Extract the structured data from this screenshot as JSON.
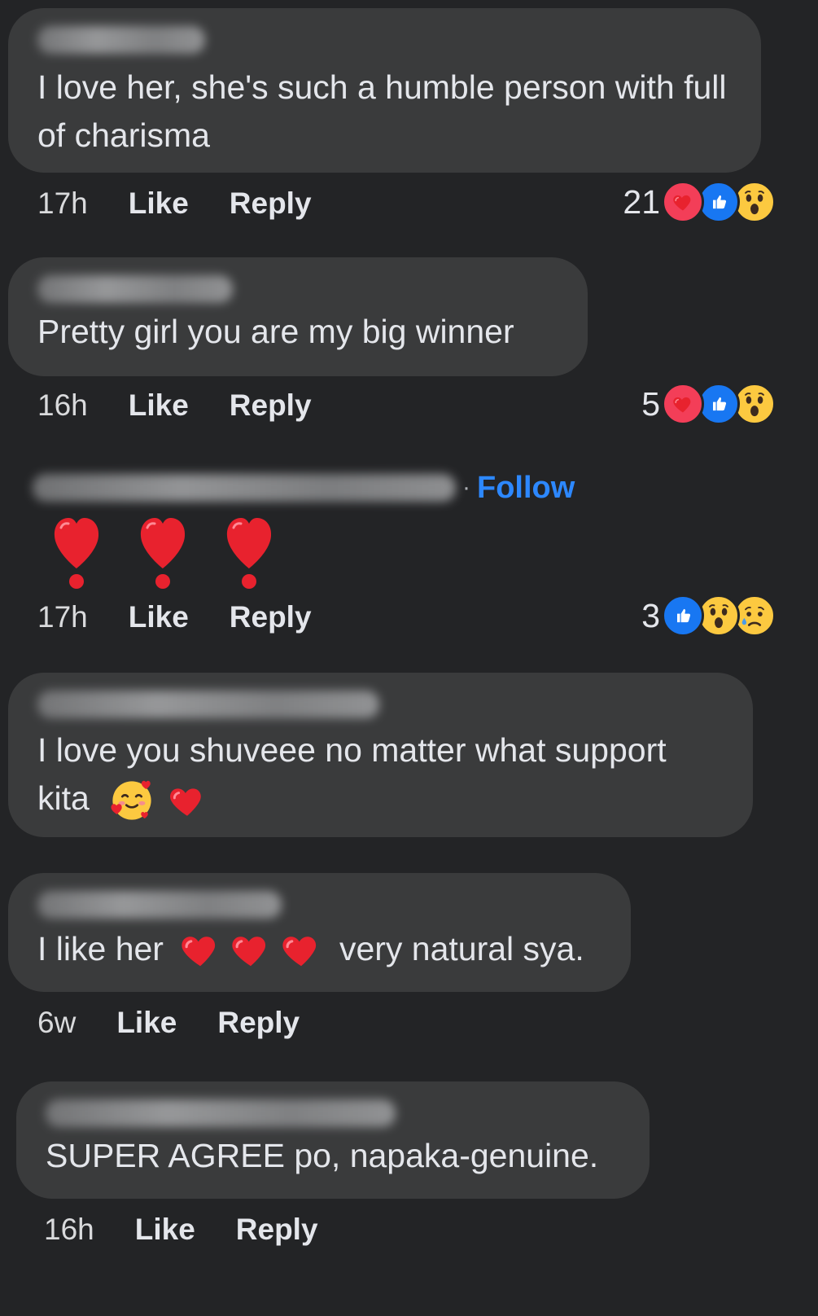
{
  "comments": [
    {
      "text": "I love her, she's such a humble person with full of charisma",
      "time": "17h",
      "like": "Like",
      "reply": "Reply",
      "reaction_count": "21",
      "reactions": [
        "love-reaction-icon",
        "like-reaction-icon",
        "wow-reaction-icon"
      ]
    },
    {
      "text": "Pretty girl you are my big winner",
      "time": "16h",
      "like": "Like",
      "reply": "Reply",
      "reaction_count": "5",
      "reactions": [
        "love-reaction-icon",
        "like-reaction-icon",
        "wow-reaction-icon"
      ]
    },
    {
      "follow": "Follow",
      "separator": "·",
      "emoji": [
        "heavy-exclamation-heart-icon",
        "heavy-exclamation-heart-icon",
        "heavy-exclamation-heart-icon"
      ],
      "time": "17h",
      "like": "Like",
      "reply": "Reply",
      "reaction_count": "3",
      "reactions": [
        "like-reaction-icon",
        "wow-reaction-icon",
        "sad-reaction-icon"
      ]
    },
    {
      "text_line1": "I love you shuveee no matter what support",
      "text_line2": "kita",
      "emoji": [
        "smiling-face-with-hearts-icon",
        "red-heart-icon"
      ]
    },
    {
      "text_before": "I like her",
      "text_after": "very natural sya.",
      "emoji": [
        "red-heart-icon",
        "red-heart-icon",
        "red-heart-icon"
      ],
      "time": "6w",
      "like": "Like",
      "reply": "Reply"
    },
    {
      "text": "SUPER AGREE po, napaka-genuine.",
      "time": "16h",
      "like": "Like",
      "reply": "Reply"
    }
  ],
  "colors": {
    "background": "#232426",
    "bubble": "#3a3b3c",
    "text": "#e4e6eb",
    "link": "#2d88ff",
    "love": "#f33e58",
    "like": "#1877f2",
    "wow": "#f7b125"
  }
}
